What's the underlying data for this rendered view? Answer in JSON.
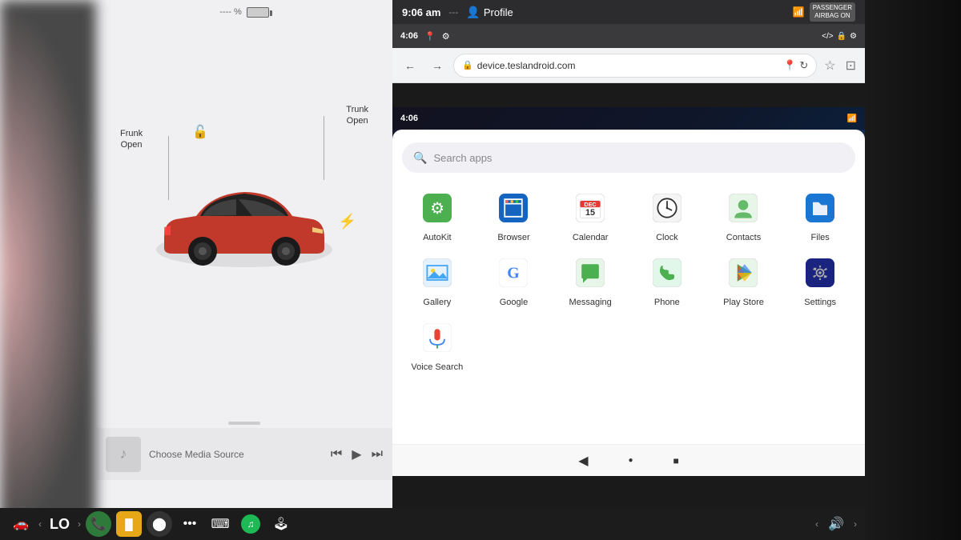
{
  "tesla": {
    "frunk_label": "Frunk\nOpen",
    "frunk_line1": "Frunk",
    "frunk_line2": "Open",
    "trunk_line1": "Trunk",
    "trunk_line2": "Open",
    "media_source": "Choose Media Source"
  },
  "taskbar": {
    "lo_text": "LO",
    "volume_icon": "🔊",
    "car_icon": "🚗",
    "phone_icon": "📞",
    "waveform_icon": "📊",
    "camera_icon": "📷",
    "dots_icon": "⋯",
    "keyboard_icon": "⌨",
    "spotify_icon": "♫",
    "joystick_icon": "🕹"
  },
  "browser": {
    "top_bar": {
      "time": "9:06 am",
      "separator": "---",
      "profile_label": "Profile",
      "wifi_icon": "wifi",
      "passenger_label": "PASSENGER\nAIRBAG ON"
    },
    "nav": {
      "url": "device.teslandroid.com",
      "back_label": "←",
      "forward_label": "→"
    },
    "android_status_time": "4:06",
    "toolbar_icons": [
      "code",
      "lock",
      "settings"
    ]
  },
  "android": {
    "status_time": "4:06",
    "search_placeholder": "Search apps",
    "apps": [
      {
        "id": "autokit",
        "label": "AutoKit",
        "icon_class": "icon-autokit",
        "emoji": "🔧"
      },
      {
        "id": "browser",
        "label": "Browser",
        "icon_class": "icon-browser",
        "emoji": "🌐"
      },
      {
        "id": "calendar",
        "label": "Calendar",
        "icon_class": "icon-calendar",
        "emoji": "📅"
      },
      {
        "id": "clock",
        "label": "Clock",
        "icon_class": "icon-clock",
        "emoji": "🕐"
      },
      {
        "id": "contacts",
        "label": "Contacts",
        "icon_class": "icon-contacts",
        "emoji": "👤"
      },
      {
        "id": "files",
        "label": "Files",
        "icon_class": "icon-files",
        "emoji": "📁"
      },
      {
        "id": "gallery",
        "label": "Gallery",
        "icon_class": "icon-gallery",
        "emoji": "🖼"
      },
      {
        "id": "google",
        "label": "Google",
        "icon_class": "icon-google",
        "emoji": "G"
      },
      {
        "id": "messaging",
        "label": "Messaging",
        "icon_class": "icon-messaging",
        "emoji": "💬"
      },
      {
        "id": "phone",
        "label": "Phone",
        "icon_class": "icon-phone",
        "emoji": "📞"
      },
      {
        "id": "playstore",
        "label": "Play Store",
        "icon_class": "icon-playstore",
        "emoji": "▶"
      },
      {
        "id": "settings",
        "label": "Settings",
        "icon_class": "icon-settings",
        "emoji": "⚙"
      },
      {
        "id": "voice-search",
        "label": "Voice Search",
        "icon_class": "icon-voice",
        "emoji": "🎤"
      }
    ]
  },
  "colors": {
    "taskbar_bg": "#1c1c1c",
    "browser_top": "#2c2c2e",
    "browser_nav_bg": "#f1f3f4",
    "android_app_bg": "white"
  }
}
